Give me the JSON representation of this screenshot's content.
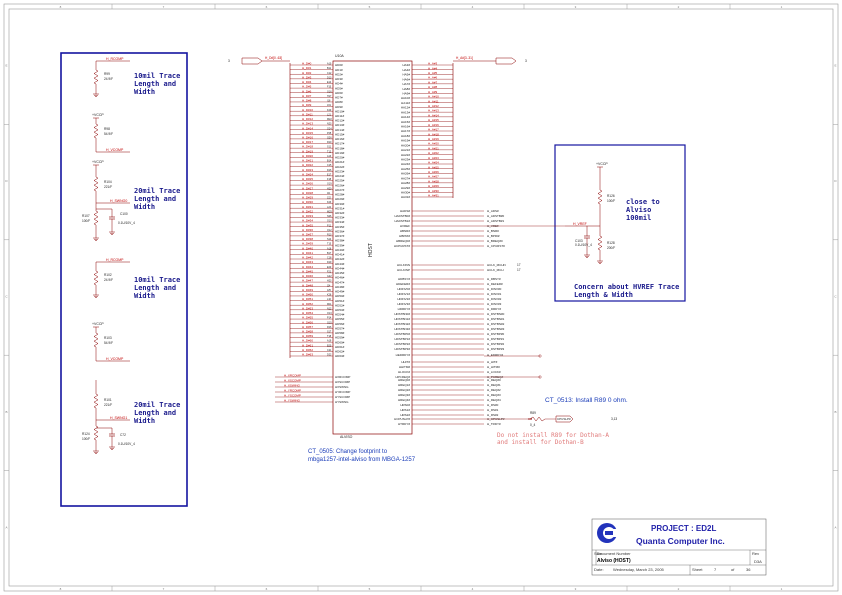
{
  "colors": {
    "frame": "#9a9a9a",
    "net": "#c00000",
    "box": "#1414a0",
    "wire": "#8b0000",
    "text": "#1a1a1a"
  },
  "border": {
    "cols": [
      "1",
      "2",
      "3",
      "4",
      "5",
      "6",
      "7",
      "8"
    ],
    "rows": [
      "A",
      "B",
      "C",
      "D",
      "E"
    ]
  },
  "left_box": {
    "notes": [
      "10mil Trace\nLength and\nWidth",
      "20mil Trace\nLength and\nWidth",
      "10mil Trace\nLength and\nWidth",
      "20mil Trace\nLength and\nWidth"
    ],
    "comp_nets": [
      "H_RCOMP",
      "H_VCOMP",
      "H_SWNG0",
      "H_RCOMP",
      "H_SWNG1"
    ],
    "vcc": [
      "+VCCP",
      "+VCCP",
      "+VCCP"
    ],
    "resistors": [
      [
        "R99",
        "24.9/F"
      ],
      [
        "R98",
        "54.9/F"
      ],
      [
        "R104",
        "221/F"
      ],
      [
        "R107",
        "100/F"
      ],
      [
        "R102",
        "24.9/F"
      ],
      [
        "R103",
        "54.9/F"
      ],
      [
        "R101",
        "221/F"
      ],
      [
        "R124",
        "100/F"
      ]
    ],
    "caps": [
      [
        "C100",
        "0.1U/10V_4"
      ],
      [
        "C72",
        "0.1U/10V_4"
      ]
    ]
  },
  "chip": {
    "ref": "U10A",
    "part": "ALVISO",
    "label": "HOST",
    "left_pins": [
      "HD0#",
      "HD1#",
      "HD2#",
      "HD3#",
      "HD4#",
      "HD5#",
      "HD6#",
      "HD7#",
      "HD8#",
      "HD9#",
      "HD10#",
      "HD11#",
      "HD12#",
      "HD13#",
      "HD14#",
      "HD15#",
      "HD16#",
      "HD17#",
      "HD18#",
      "HD19#",
      "HD20#",
      "HD21#",
      "HD22#",
      "HD23#",
      "HD24#",
      "HD25#",
      "HD26#",
      "HD27#",
      "HD28#",
      "HD29#",
      "HD30#",
      "HD31#",
      "HD32#",
      "HD33#",
      "HD34#",
      "HD35#",
      "HD36#",
      "HD37#",
      "HD38#",
      "HD39#",
      "HD40#",
      "HD41#",
      "HD42#",
      "HD43#",
      "HD44#",
      "HD45#",
      "HD46#",
      "HD47#",
      "HD48#",
      "HD49#",
      "HD50#",
      "HD51#",
      "HD52#",
      "HD53#",
      "HD54#",
      "HD55#",
      "HD56#",
      "HD57#",
      "HD58#",
      "HD59#",
      "HD60#",
      "HD61#",
      "HD62#",
      "HD63#"
    ],
    "left_nets": [
      "H_D#0",
      "H_D#1",
      "H_D#2",
      "H_D#3",
      "H_D#4",
      "H_D#5",
      "H_D#6",
      "H_D#7",
      "H_D#8",
      "H_D#9",
      "H_D#10",
      "H_D#11",
      "H_D#12",
      "H_D#13",
      "H_D#14",
      "H_D#15",
      "H_D#16",
      "H_D#17",
      "H_D#18",
      "H_D#19",
      "H_D#20",
      "H_D#21",
      "H_D#22",
      "H_D#23",
      "H_D#24",
      "H_D#25",
      "H_D#26",
      "H_D#27",
      "H_D#28",
      "H_D#29",
      "H_D#30",
      "H_D#31",
      "H_D#32",
      "H_D#33",
      "H_D#34",
      "H_D#35",
      "H_D#36",
      "H_D#37",
      "H_D#38",
      "H_D#39",
      "H_D#40",
      "H_D#41",
      "H_D#42",
      "H_D#43",
      "H_D#44",
      "H_D#45",
      "H_D#46",
      "H_D#47",
      "H_D#48",
      "H_D#49",
      "H_D#50",
      "H_D#51",
      "H_D#52",
      "H_D#53",
      "H_D#54",
      "H_D#55",
      "H_D#56",
      "H_D#57",
      "H_D#58",
      "H_D#59",
      "H_D#60",
      "H_D#61",
      "H_D#62",
      "H_D#63"
    ],
    "comp_pins": [
      "HXRCOMP",
      "HXSCOMP",
      "HXSWNG",
      "HYRCOMP",
      "HYSCOMP",
      "HYSWNG"
    ],
    "comp_nets": [
      "H_XRCOMP",
      "H_XSCOMP",
      "H_XSWING",
      "H_YRCOMP",
      "H_YSCOMP",
      "H_YSWING"
    ],
    "right_addr_pins": [
      "HA3#",
      "HA4#",
      "HA5#",
      "HA6#",
      "HA7#",
      "HA8#",
      "HA9#",
      "HA10#",
      "HA11#",
      "HA12#",
      "HA13#",
      "HA14#",
      "HA15#",
      "HA16#",
      "HA17#",
      "HA18#",
      "HA19#",
      "HA20#",
      "HA21#",
      "HA22#",
      "HA23#",
      "HA24#",
      "HA25#",
      "HA26#",
      "HA27#",
      "HA28#",
      "HA29#",
      "HA30#",
      "HA31#"
    ],
    "right_addr_nets": [
      "H_A#3",
      "H_A#4",
      "H_A#5",
      "H_A#6",
      "H_A#7",
      "H_A#8",
      "H_A#9",
      "H_A#10",
      "H_A#11",
      "H_A#12",
      "H_A#13",
      "H_A#14",
      "H_A#15",
      "H_A#16",
      "H_A#17",
      "H_A#18",
      "H_A#19",
      "H_A#20",
      "H_A#21",
      "H_A#22",
      "H_A#23",
      "H_A#24",
      "H_A#25",
      "H_A#26",
      "H_A#27",
      "H_A#28",
      "H_A#29",
      "H_A#30",
      "H_A#31"
    ],
    "right_ctl_pins": [
      "HADS#",
      "HADSTB0#",
      "HADSTB1#",
      "HVREF",
      "HBNR#",
      "HBPRI#",
      "HBREQ0#",
      "HCPURST#",
      "HCLKINN",
      "HCLKINP",
      "HDBSY#",
      "HDEFER#",
      "HDINV0#",
      "HDINV1#",
      "HDINV2#",
      "HDINV3#",
      "HDRDY#",
      "HDSTBN0#",
      "HDSTBN1#",
      "HDSTBN2#",
      "HDSTBN3#",
      "HDSTBP0#",
      "HDSTBP1#",
      "HDSTBP2#",
      "HDSTBP3#",
      "HEDRDY#",
      "HHIT#",
      "HHITM#",
      "HLOCK#",
      "HPCREQ#",
      "HREQ0#",
      "HREQ1#",
      "HREQ2#",
      "HREQ3#",
      "HREQ4#",
      "HRS0#",
      "HRS1#",
      "HRS2#",
      "HCPUSLP#",
      "HTRDY#"
    ],
    "right_ctl_nets": [
      "H_ADS#",
      "H_ADSTB#0",
      "H_ADSTB#1",
      "H_VREF",
      "H_BNR#",
      "H_BPRI#",
      "H_BREQ#0",
      "H_CPURST#",
      "HCLK_MCHN",
      "HCLK_MCH",
      "H_DBSY#",
      "H_DEFER#",
      "H_DINV#0",
      "H_DINV#1",
      "H_DINV#2",
      "H_DINV#3",
      "H_DRDY#",
      "H_DSTBN#0",
      "H_DSTBN#1",
      "H_DSTBN#2",
      "H_DSTBN#3",
      "H_DSTBP#0",
      "H_DSTBP#1",
      "H_DSTBP#2",
      "H_DSTBP#3",
      "H_EDRDY#",
      "H_HIT#",
      "H_HITM#",
      "H_LOCK#",
      "H_PCREQ#",
      "H_REQ#0",
      "H_REQ#1",
      "H_REQ#2",
      "H_REQ#3",
      "H_REQ#4",
      "H_RS#0",
      "H_RS#1",
      "H_RS#2",
      "H_CPUSLP#",
      "H_TRDY#"
    ]
  },
  "offpage": {
    "left": "H_D#[0..63]",
    "right": "H_A#[3..31]",
    "left_num": "3",
    "right_num": "3",
    "clk_num": "17",
    "cpuslp": "CPUSLP#",
    "cpuslp_num": "3,13"
  },
  "right_box": {
    "vcc": "+VCCP",
    "r_top": [
      "R126",
      "100/F"
    ],
    "r_bot": [
      "R128",
      "200/F"
    ],
    "cap": [
      "C103",
      "0.1U/10V_4"
    ],
    "net": "H_VREF",
    "note1": "close to\nAlviso\n100mil",
    "note2": "Concern about HVREF Trace\nLength & Width"
  },
  "notes": {
    "ct0505": "CT_0505: Change footprint to\nmbga1257-intel-alviso from MBGA-1257",
    "ct0513": "CT_0513: Install R89 0 ohm.",
    "no_install": "Do not install R89 for Dothan-A\nand install for Dothan-B",
    "r89": [
      "R89",
      "0_4"
    ]
  },
  "title_block": {
    "project": "PROJECT : ED2L",
    "company": "Quanta Computer Inc.",
    "size_label": "Size",
    "doc_label": "Document Number",
    "rev_label": "Rev",
    "doc": "Alviso (HOST)",
    "rev": "D3A",
    "date_label": "Date:",
    "date": "Wednesday, March 23, 2005",
    "sheet_label": "Sheet",
    "sheet": "7",
    "of_label": "of",
    "of": "36"
  }
}
